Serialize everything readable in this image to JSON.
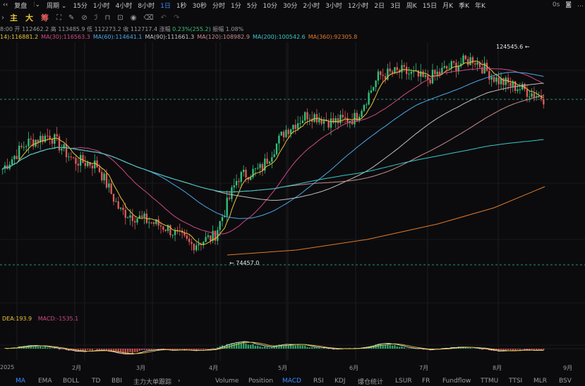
{
  "toolbar": {
    "replay": "复盘",
    "period": "周期",
    "intervals": [
      "15分",
      "1小时",
      "4小时",
      "8小时",
      "1日",
      "1秒",
      "30秒",
      "分时",
      "1分",
      "5分",
      "10分",
      "30分",
      "2小时",
      "3小时",
      "12小时",
      "2日",
      "3日",
      "周K",
      "15日",
      "月K",
      "季K",
      "年K"
    ],
    "active_interval": "1日",
    "timer": "0s"
  },
  "tools": {
    "main_chars": [
      "主",
      "大",
      "筹"
    ]
  },
  "info": {
    "date_time_fragment": "8:00",
    "open_label": "开",
    "open": "112462.2",
    "high_label": "高",
    "high": "113485.9",
    "low_label": "低",
    "low": "112273.2",
    "close_label": "收",
    "close": "112717.4",
    "change_label": "涨幅",
    "change": "0.23%(255.2)",
    "amp_label": "振幅",
    "amplitude": "1.08%"
  },
  "ma_legend": [
    {
      "text": "14):116881.2",
      "color": "#e8c43b"
    },
    {
      "text": "MA(30):116563.3",
      "color": "#d04a84"
    },
    {
      "text": "MA(60):114641.1",
      "color": "#4aa8e8"
    },
    {
      "text": "MA(90):111661.3",
      "color": "#c0c0c0"
    },
    {
      "text": "MA(120):108982.9",
      "color": "#c88c8c"
    },
    {
      "text": "MA(200):100542.6",
      "color": "#3ac8c8"
    },
    {
      "text": "MA(360):92305.8",
      "color": "#e07a2a"
    }
  ],
  "price_labels": {
    "high": "124545.6",
    "low": "74457.0"
  },
  "indicator": {
    "dea": "DEA:193.9",
    "macd": "MACD:-1535.1"
  },
  "x_axis": [
    "2025",
    "2月",
    "3月",
    "4月",
    "5月",
    "6月",
    "7月",
    "8月",
    "9月"
  ],
  "bottom_tabs": [
    "MA",
    "EMA",
    "BOLL",
    "TD",
    "BBI",
    "主力大单跟踪",
    "Volume",
    "Position",
    "MACD",
    "RSI",
    "KDJ",
    "爆仓统计",
    "LSUR",
    "FR",
    "Fundflow",
    "TTMU",
    "TTSI",
    "MLR",
    "BSV"
  ],
  "active_tab_main": "MA",
  "active_tab_sub": "MACD",
  "colors": {
    "up": "#35c17b",
    "down": "#e05a5a",
    "accent": "#3d8bff",
    "background": "#0b0b0d"
  },
  "chart_data": {
    "type": "line",
    "close_path_estimate": [
      96000,
      102000,
      104000,
      98000,
      97000,
      86000,
      84000,
      82000,
      78000,
      80000,
      94000,
      96000,
      105000,
      109000,
      107000,
      108000,
      118000,
      119000,
      117000,
      120000,
      122000,
      117000,
      115000,
      112700
    ],
    "high_marker": 124545.6,
    "low_marker": 74457.0
  }
}
